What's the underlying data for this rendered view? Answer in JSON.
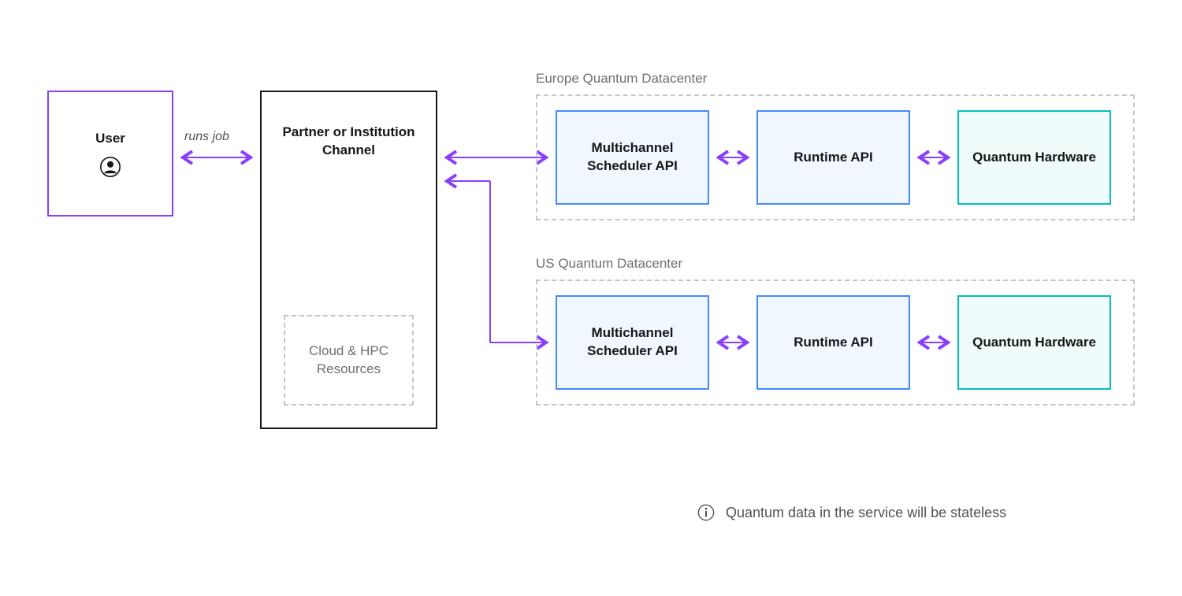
{
  "user": {
    "label": "User"
  },
  "edge": {
    "runs_job": "runs job"
  },
  "partner": {
    "label": "Partner or Institution Channel",
    "resources_label": "Cloud & HPC Resources"
  },
  "datacenters": {
    "eu": {
      "label": "Europe Quantum Datacenter",
      "scheduler": "Multichannel Scheduler API",
      "runtime": "Runtime API",
      "hardware": "Quantum Hardware"
    },
    "us": {
      "label": "US Quantum Datacenter",
      "scheduler": "Multichannel Scheduler API",
      "runtime": "Runtime API",
      "hardware": "Quantum Hardware"
    }
  },
  "info": {
    "note": "Quantum data in the service will be stateless"
  }
}
